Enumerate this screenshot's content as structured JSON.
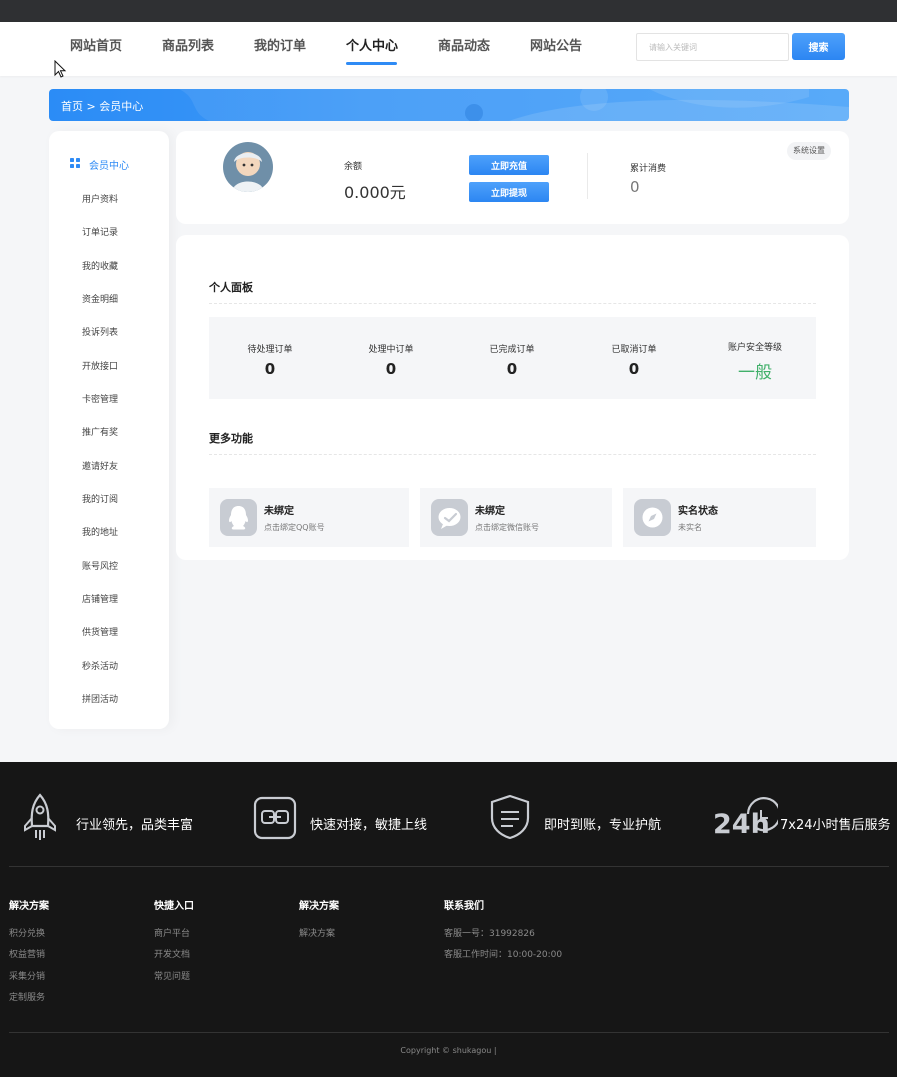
{
  "nav": {
    "items": [
      {
        "label": "网站首页"
      },
      {
        "label": "商品列表"
      },
      {
        "label": "我的订单"
      },
      {
        "label": "个人中心"
      },
      {
        "label": "商品动态"
      },
      {
        "label": "网站公告"
      }
    ],
    "active_label": "个人中心",
    "search_placeholder": "请输入关键词",
    "search_button": "搜索"
  },
  "breadcrumb": "首页 > 会员中心",
  "sidebar": {
    "title": "会员中心",
    "items": [
      "用户资料",
      "订单记录",
      "我的收藏",
      "资金明细",
      "投诉列表",
      "开放接口",
      "卡密管理",
      "推广有奖",
      "邀请好友",
      "我的订阅",
      "我的地址",
      "账号风控",
      "店铺管理",
      "供货管理",
      "秒杀活动",
      "拼团活动"
    ]
  },
  "account": {
    "balance_label": "余额",
    "balance_value": "0.000元",
    "recharge_button": "立即充值",
    "withdraw_button": "立即提现",
    "spend_label": "累计消费",
    "spend_value": "0",
    "settings_label": "系统设置"
  },
  "panel": {
    "title": "个人面板",
    "stats": [
      {
        "label": "待处理订单",
        "value": "0"
      },
      {
        "label": "处理中订单",
        "value": "0"
      },
      {
        "label": "已完成订单",
        "value": "0"
      },
      {
        "label": "已取消订单",
        "value": "0"
      },
      {
        "label": "账户安全等级",
        "value": "一般"
      }
    ],
    "security_color": "#41b06a"
  },
  "more": {
    "title": "更多功能",
    "cards": [
      {
        "icon": "qq-icon",
        "title": "未绑定",
        "sub": "点击绑定QQ账号"
      },
      {
        "icon": "wechat-icon",
        "title": "未绑定",
        "sub": "点击绑定微信账号"
      },
      {
        "icon": "compass-icon",
        "title": "实名状态",
        "sub": "未实名"
      }
    ]
  },
  "footer": {
    "features": [
      {
        "icon": "rocket-icon",
        "text": "行业领先，品类丰富"
      },
      {
        "icon": "link-icon",
        "text": "快速对接，敏捷上线"
      },
      {
        "icon": "shield-icon",
        "text": "即时到账，专业护航"
      },
      {
        "icon": "24h-icon",
        "text": "7x24小时售后服务"
      }
    ],
    "columns": [
      {
        "title": "解决方案",
        "links": [
          "积分兑换",
          "权益营销",
          "采集分销",
          "定制服务"
        ]
      },
      {
        "title": "快捷入口",
        "links": [
          "商户平台",
          "开发文档",
          "常见问题"
        ]
      },
      {
        "title": "解决方案",
        "links": [
          "解决方案"
        ]
      },
      {
        "title": "联系我们",
        "links": [
          "客服一号：31992826",
          "客服工作时间：10:00-20:00"
        ]
      }
    ],
    "copyright": "Copyright © shukagou |",
    "icon_24h_text": "24h"
  },
  "colors": {
    "accent": "#2f8bf5",
    "footer_bg": "#161616",
    "topbar": "#2f3033"
  }
}
